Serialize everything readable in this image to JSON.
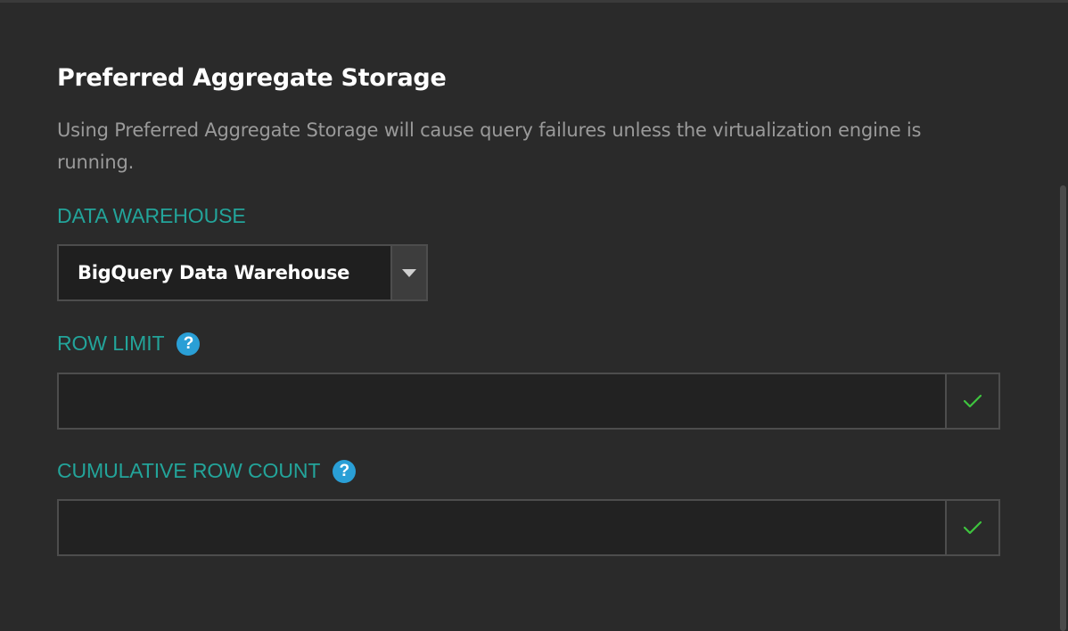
{
  "section": {
    "title": "Preferred Aggregate Storage",
    "description": "Using Preferred Aggregate Storage will cause query failures unless the virtualization engine is running."
  },
  "data_warehouse": {
    "label": "DATA WAREHOUSE",
    "selected": "BigQuery Data Warehouse"
  },
  "row_limit": {
    "label": "ROW LIMIT",
    "value": "",
    "help_icon": "question-circle-icon",
    "confirm_icon": "check-icon"
  },
  "cumulative_row_count": {
    "label": "CUMULATIVE ROW COUNT",
    "value": "",
    "help_icon": "question-circle-icon",
    "confirm_icon": "check-icon"
  },
  "colors": {
    "accent_label": "#23a49a",
    "help_icon": "#2a9fd6",
    "check": "#3ec43e",
    "background": "#2a2a2a"
  }
}
